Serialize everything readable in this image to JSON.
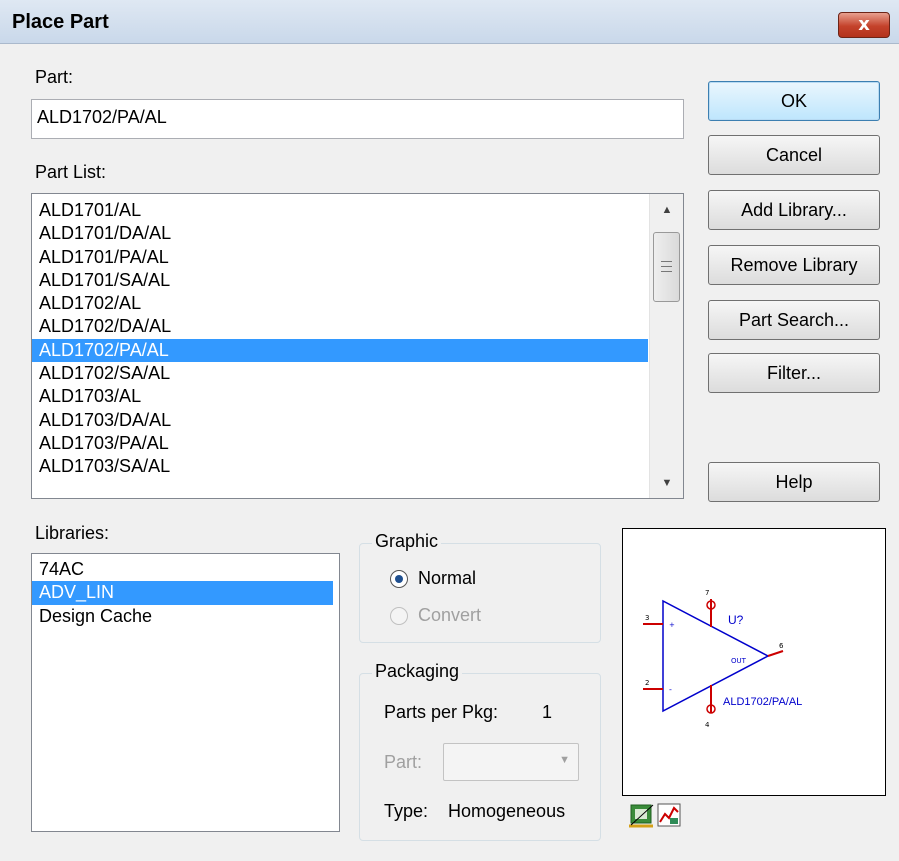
{
  "window": {
    "title": "Place Part",
    "close_label": "x"
  },
  "part": {
    "label": "Part:",
    "value": "ALD1702/PA/AL"
  },
  "part_list": {
    "label": "Part List:",
    "items": [
      "ALD1701/AL",
      "ALD1701/DA/AL",
      "ALD1701/PA/AL",
      "ALD1701/SA/AL",
      "ALD1702/AL",
      "ALD1702/DA/AL",
      "ALD1702/PA/AL",
      "ALD1702/SA/AL",
      "ALD1703/AL",
      "ALD1703/DA/AL",
      "ALD1703/PA/AL",
      "ALD1703/SA/AL"
    ],
    "selected": "ALD1702/PA/AL"
  },
  "buttons": {
    "ok": "OK",
    "cancel": "Cancel",
    "add_library": "Add Library...",
    "remove_library": "Remove Library",
    "part_search": "Part Search...",
    "filter": "Filter...",
    "help": "Help"
  },
  "libraries": {
    "label": "Libraries:",
    "items": [
      "74AC",
      "ADV_LIN",
      "Design Cache"
    ],
    "selected": "ADV_LIN"
  },
  "graphic": {
    "title": "Graphic",
    "normal_label": "Normal",
    "convert_label": "Convert",
    "selected": "Normal"
  },
  "packaging": {
    "title": "Packaging",
    "parts_per_pkg_label": "Parts per Pkg:",
    "parts_per_pkg_value": "1",
    "part_label": "Part:",
    "part_value": "",
    "type_label": "Type:",
    "type_value": "Homogeneous"
  },
  "preview": {
    "refdes": "U?",
    "part_name": "ALD1702/PA/AL",
    "out_label": "OUT",
    "pins": {
      "in_plus": "3",
      "in_minus": "2",
      "out": "6",
      "v_plus": "7",
      "v_minus": "4"
    }
  },
  "colors": {
    "selection": "#3399ff",
    "schematic_body": "#0000cc",
    "schematic_pin": "#cc0000"
  }
}
